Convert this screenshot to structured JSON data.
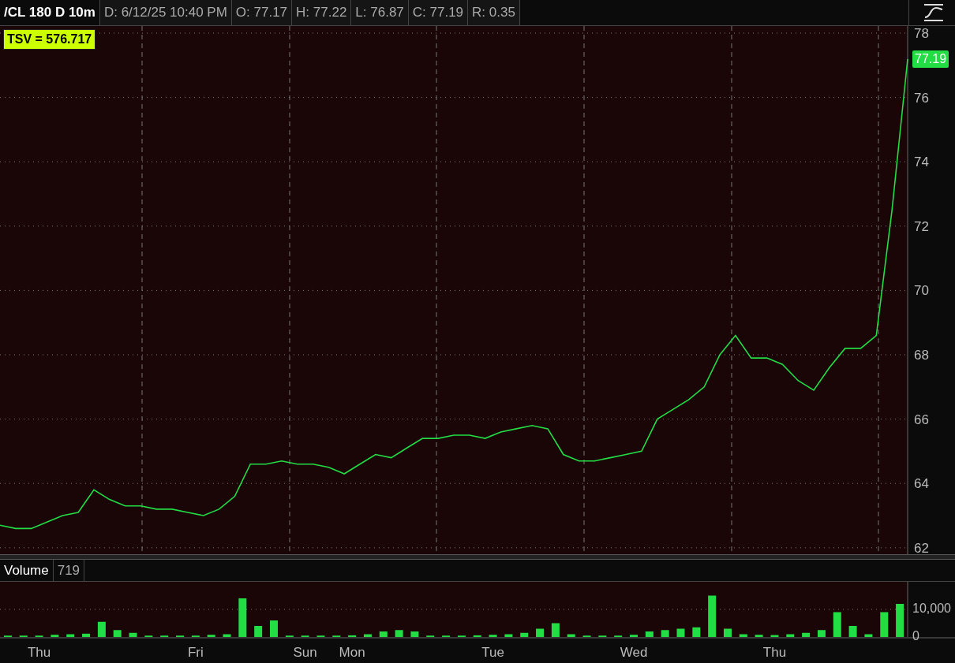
{
  "header": {
    "symbol": "/CL 180 D 10m",
    "fields": [
      "D: 6/12/25 10:40 PM",
      "O: 77.17",
      "H: 77.22",
      "L: 76.87",
      "C: 77.19",
      "R: 0.35"
    ]
  },
  "study_label": "TSV  = 576.717",
  "price_badge": "77.19",
  "price_chart": {
    "chart_data": {
      "type": "line",
      "grid": true,
      "series": [
        {
          "color": "#22dd44",
          "values": [
            62.7,
            62.6,
            62.6,
            62.8,
            63.0,
            63.1,
            63.8,
            63.5,
            63.3,
            63.3,
            63.2,
            63.2,
            63.1,
            63.0,
            63.2,
            63.6,
            64.6,
            64.6,
            64.7,
            64.6,
            64.6,
            64.5,
            64.3,
            64.6,
            64.9,
            64.8,
            65.1,
            65.4,
            65.4,
            65.5,
            65.5,
            65.4,
            65.6,
            65.7,
            65.8,
            65.7,
            64.9,
            64.7,
            64.7,
            64.8,
            64.9,
            65.0,
            66.0,
            66.3,
            66.6,
            67.0,
            68.0,
            68.6,
            67.9,
            67.9,
            67.7,
            67.2,
            66.9,
            67.6,
            68.2,
            68.2,
            68.6,
            72.5,
            77.19
          ]
        }
      ],
      "ylim": [
        61.8,
        78.22
      ],
      "yticks": [
        62,
        64,
        66,
        68,
        70,
        72,
        74,
        76,
        78
      ]
    }
  },
  "volume_panel": {
    "title": "Volume",
    "value": "719",
    "chart_data": {
      "type": "bar",
      "grid": true,
      "ylim": [
        0,
        20000
      ],
      "categories": [
        null,
        null,
        "Thu",
        null,
        null,
        null,
        null,
        null,
        null,
        null,
        null,
        null,
        "Fri",
        null,
        null,
        null,
        null,
        null,
        null,
        "Sun",
        null,
        null,
        "Mon",
        null,
        null,
        null,
        null,
        null,
        null,
        null,
        null,
        "Tue",
        null,
        null,
        null,
        null,
        null,
        null,
        null,
        null,
        "Wed",
        null,
        null,
        null,
        null,
        null,
        null,
        null,
        null,
        "Thu",
        null,
        null,
        null,
        null,
        null,
        null,
        null,
        null
      ],
      "series": [
        {
          "color": "#22dd44",
          "values": [
            500,
            500,
            500,
            800,
            1000,
            1200,
            5500,
            2500,
            1500,
            500,
            500,
            500,
            500,
            800,
            1000,
            14000,
            4000,
            6000,
            500,
            500,
            500,
            500,
            600,
            1000,
            2000,
            2500,
            2000,
            500,
            500,
            500,
            600,
            800,
            1000,
            1500,
            3000,
            5000,
            1000,
            500,
            500,
            500,
            800,
            2000,
            2500,
            3000,
            3500,
            15000,
            3000,
            1000,
            800,
            700,
            1000,
            1500,
            2500,
            9000,
            4000,
            1000,
            9000,
            12000
          ]
        }
      ],
      "yticks": [
        {
          "value": 0,
          "label": "0"
        },
        {
          "value": 10000,
          "label": "10,000"
        }
      ]
    }
  }
}
